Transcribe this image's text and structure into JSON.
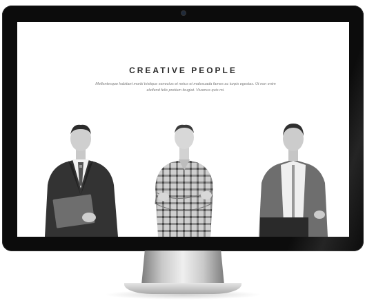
{
  "section": {
    "title": "CREATIVE PEOPLE",
    "description": "Mellentesque habitant morbi tristique senectus et netus et malesuada fames ac turpis egestas. Ut non enim eleifend felis pretium feugiat. Vivamus quis mi."
  },
  "team": [
    {
      "icon": "person-suit-laptop-icon"
    },
    {
      "icon": "person-plaid-shirt-arms-crossed-icon"
    },
    {
      "icon": "person-cardigan-laptop-icon"
    }
  ],
  "colors": {
    "monitor_bezel": "#0c0c0c",
    "screen_bg": "#ffffff",
    "title_text": "#2a2a2a",
    "body_text": "#7c7c7c"
  }
}
